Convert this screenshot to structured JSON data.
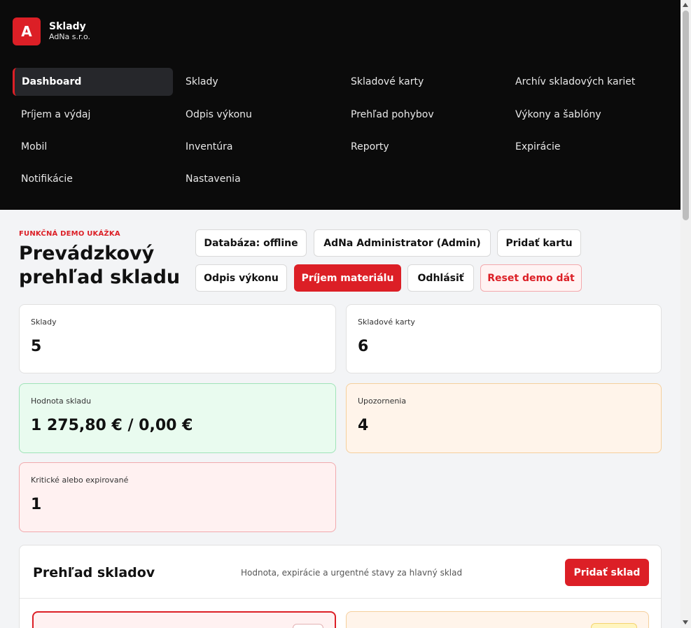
{
  "brand": {
    "logo_letter": "A",
    "title": "Sklady",
    "subtitle": "AdNa s.r.o."
  },
  "nav": [
    {
      "label": "Dashboard",
      "active": true
    },
    {
      "label": "Sklady"
    },
    {
      "label": "Skladové karty"
    },
    {
      "label": "Archív skladových kariet"
    },
    {
      "label": "Príjem a výdaj"
    },
    {
      "label": "Odpis výkonu"
    },
    {
      "label": "Prehľad pohybov"
    },
    {
      "label": "Výkony a šablóny"
    },
    {
      "label": "Mobil"
    },
    {
      "label": "Inventúra"
    },
    {
      "label": "Reporty"
    },
    {
      "label": "Expirácie"
    },
    {
      "label": "Notifikácie"
    },
    {
      "label": "Nastavenia"
    }
  ],
  "hero": {
    "eyebrow": "FUNKČNÁ DEMO UKÁŽKA",
    "title": "Prevádzkový prehľad skladu"
  },
  "actions": {
    "database": "Databáza: offline",
    "user": "AdNa Administrator (Admin)",
    "add_card": "Pridať kartu",
    "writeoff": "Odpis výkonu",
    "receive": "Príjem materiálu",
    "logout": "Odhlásiť",
    "reset": "Reset demo dát"
  },
  "stats": {
    "warehouses": {
      "label": "Sklady",
      "value": "5"
    },
    "cards": {
      "label": "Skladové karty",
      "value": "6"
    },
    "stock_value": {
      "label": "Hodnota skladu",
      "value": "1 275,80 € / 0,00 €"
    },
    "alerts": {
      "label": "Upozornenia",
      "value": "4"
    },
    "critical": {
      "label": "Kritické alebo expirované",
      "value": "1"
    }
  },
  "overview": {
    "title": "Prehľad skladov",
    "subtitle": "Hodnota, expirácie a urgentné stavy za hlavný sklad",
    "add_button": "Pridať sklad"
  },
  "colors": {
    "accent": "#dc1f26",
    "header_bg": "#0b0b0b",
    "success_bg": "#e9fbef",
    "warning_bg": "#fff4ea",
    "danger_bg": "#fff1f1"
  }
}
